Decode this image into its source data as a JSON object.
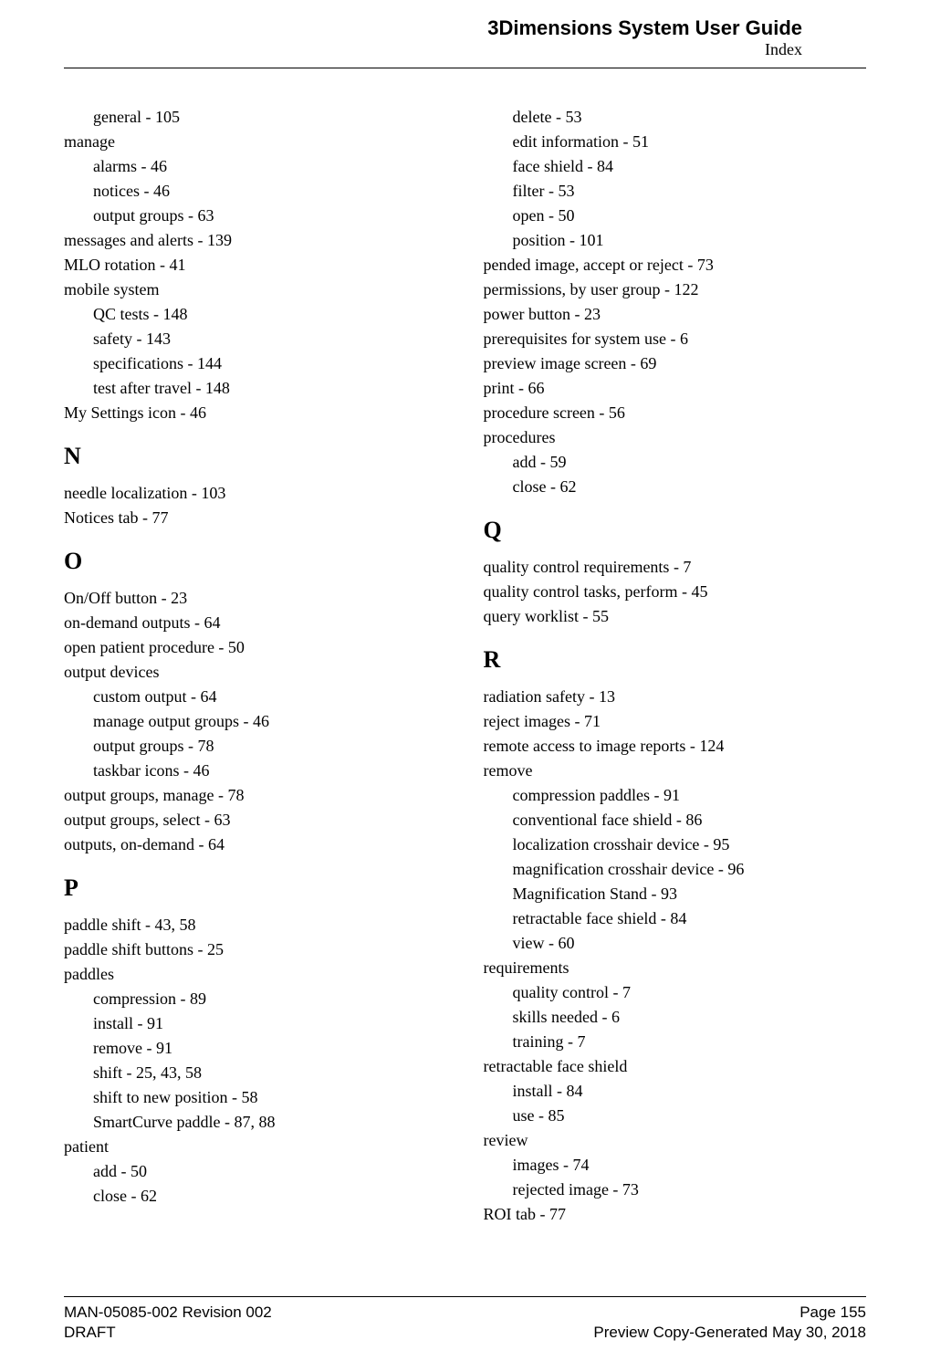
{
  "header": {
    "title": "3Dimensions System User Guide",
    "section": "Index"
  },
  "left": [
    {
      "lvl": 1,
      "text": "general - 105"
    },
    {
      "lvl": 0,
      "text": "manage"
    },
    {
      "lvl": 1,
      "text": "alarms - 46"
    },
    {
      "lvl": 1,
      "text": "notices - 46"
    },
    {
      "lvl": 1,
      "text": "output groups - 63"
    },
    {
      "lvl": 0,
      "text": "messages and alerts - 139"
    },
    {
      "lvl": 0,
      "text": "MLO rotation - 41"
    },
    {
      "lvl": 0,
      "text": "mobile system"
    },
    {
      "lvl": 1,
      "text": "QC tests - 148"
    },
    {
      "lvl": 1,
      "text": "safety - 143"
    },
    {
      "lvl": 1,
      "text": "specifications - 144"
    },
    {
      "lvl": 1,
      "text": "test after travel - 148"
    },
    {
      "lvl": 0,
      "text": "My Settings icon - 46"
    },
    {
      "lvl": "h",
      "text": "N"
    },
    {
      "lvl": 0,
      "text": "needle localization - 103"
    },
    {
      "lvl": 0,
      "text": "Notices tab - 77"
    },
    {
      "lvl": "h",
      "text": "O"
    },
    {
      "lvl": 0,
      "text": "On/Off button - 23"
    },
    {
      "lvl": 0,
      "text": "on-demand outputs - 64"
    },
    {
      "lvl": 0,
      "text": "open patient procedure - 50"
    },
    {
      "lvl": 0,
      "text": "output devices"
    },
    {
      "lvl": 1,
      "text": "custom output - 64"
    },
    {
      "lvl": 1,
      "text": "manage output groups - 46"
    },
    {
      "lvl": 1,
      "text": "output groups - 78"
    },
    {
      "lvl": 1,
      "text": "taskbar icons - 46"
    },
    {
      "lvl": 0,
      "text": "output groups, manage - 78"
    },
    {
      "lvl": 0,
      "text": "output groups, select - 63"
    },
    {
      "lvl": 0,
      "text": "outputs, on-demand - 64"
    },
    {
      "lvl": "h",
      "text": "P"
    },
    {
      "lvl": 0,
      "text": "paddle shift - 43, 58"
    },
    {
      "lvl": 0,
      "text": "paddle shift buttons - 25"
    },
    {
      "lvl": 0,
      "text": "paddles"
    },
    {
      "lvl": 1,
      "text": "compression - 89"
    },
    {
      "lvl": 1,
      "text": "install - 91"
    },
    {
      "lvl": 1,
      "text": "remove - 91"
    },
    {
      "lvl": 1,
      "text": "shift - 25, 43, 58"
    },
    {
      "lvl": 1,
      "text": "shift to new position - 58"
    },
    {
      "lvl": 1,
      "text": "SmartCurve paddle - 87, 88"
    },
    {
      "lvl": 0,
      "text": "patient"
    },
    {
      "lvl": 1,
      "text": "add - 50"
    },
    {
      "lvl": 1,
      "text": "close - 62"
    }
  ],
  "right": [
    {
      "lvl": 1,
      "text": "delete - 53"
    },
    {
      "lvl": 1,
      "text": "edit information - 51"
    },
    {
      "lvl": 1,
      "text": "face shield - 84"
    },
    {
      "lvl": 1,
      "text": "filter - 53"
    },
    {
      "lvl": 1,
      "text": "open - 50"
    },
    {
      "lvl": 1,
      "text": "position - 101"
    },
    {
      "lvl": 0,
      "text": "pended image, accept or reject - 73"
    },
    {
      "lvl": 0,
      "text": "permissions, by user group - 122"
    },
    {
      "lvl": 0,
      "text": "power button - 23"
    },
    {
      "lvl": 0,
      "text": "prerequisites for system use - 6"
    },
    {
      "lvl": 0,
      "text": "preview image screen - 69"
    },
    {
      "lvl": 0,
      "text": "print - 66"
    },
    {
      "lvl": 0,
      "text": "procedure screen - 56"
    },
    {
      "lvl": 0,
      "text": "procedures"
    },
    {
      "lvl": 1,
      "text": "add - 59"
    },
    {
      "lvl": 1,
      "text": "close - 62"
    },
    {
      "lvl": "h",
      "text": "Q"
    },
    {
      "lvl": 0,
      "text": "quality control requirements - 7"
    },
    {
      "lvl": 0,
      "text": "quality control tasks, perform - 45"
    },
    {
      "lvl": 0,
      "text": "query worklist - 55"
    },
    {
      "lvl": "h",
      "text": "R"
    },
    {
      "lvl": 0,
      "text": "radiation safety - 13"
    },
    {
      "lvl": 0,
      "text": "reject images - 71"
    },
    {
      "lvl": 0,
      "text": "remote access to image reports - 124"
    },
    {
      "lvl": 0,
      "text": "remove"
    },
    {
      "lvl": 1,
      "text": "compression paddles - 91"
    },
    {
      "lvl": 1,
      "text": "conventional face shield - 86"
    },
    {
      "lvl": 1,
      "text": "localization crosshair device - 95"
    },
    {
      "lvl": 1,
      "text": "magnification crosshair device - 96"
    },
    {
      "lvl": 1,
      "text": "Magnification Stand - 93"
    },
    {
      "lvl": 1,
      "text": "retractable face shield - 84"
    },
    {
      "lvl": 1,
      "text": "view - 60"
    },
    {
      "lvl": 0,
      "text": "requirements"
    },
    {
      "lvl": 1,
      "text": "quality control - 7"
    },
    {
      "lvl": 1,
      "text": "skills needed - 6"
    },
    {
      "lvl": 1,
      "text": "training - 7"
    },
    {
      "lvl": 0,
      "text": "retractable face shield"
    },
    {
      "lvl": 1,
      "text": "install - 84"
    },
    {
      "lvl": 1,
      "text": "use - 85"
    },
    {
      "lvl": 0,
      "text": "review"
    },
    {
      "lvl": 1,
      "text": "images - 74"
    },
    {
      "lvl": 1,
      "text": "rejected image - 73"
    },
    {
      "lvl": 0,
      "text": "ROI tab - 77"
    }
  ],
  "footer": {
    "left1": "MAN-05085-002 Revision 002",
    "left2": "DRAFT",
    "right1": "Page 155",
    "right2": "Preview Copy-Generated May 30, 2018"
  }
}
